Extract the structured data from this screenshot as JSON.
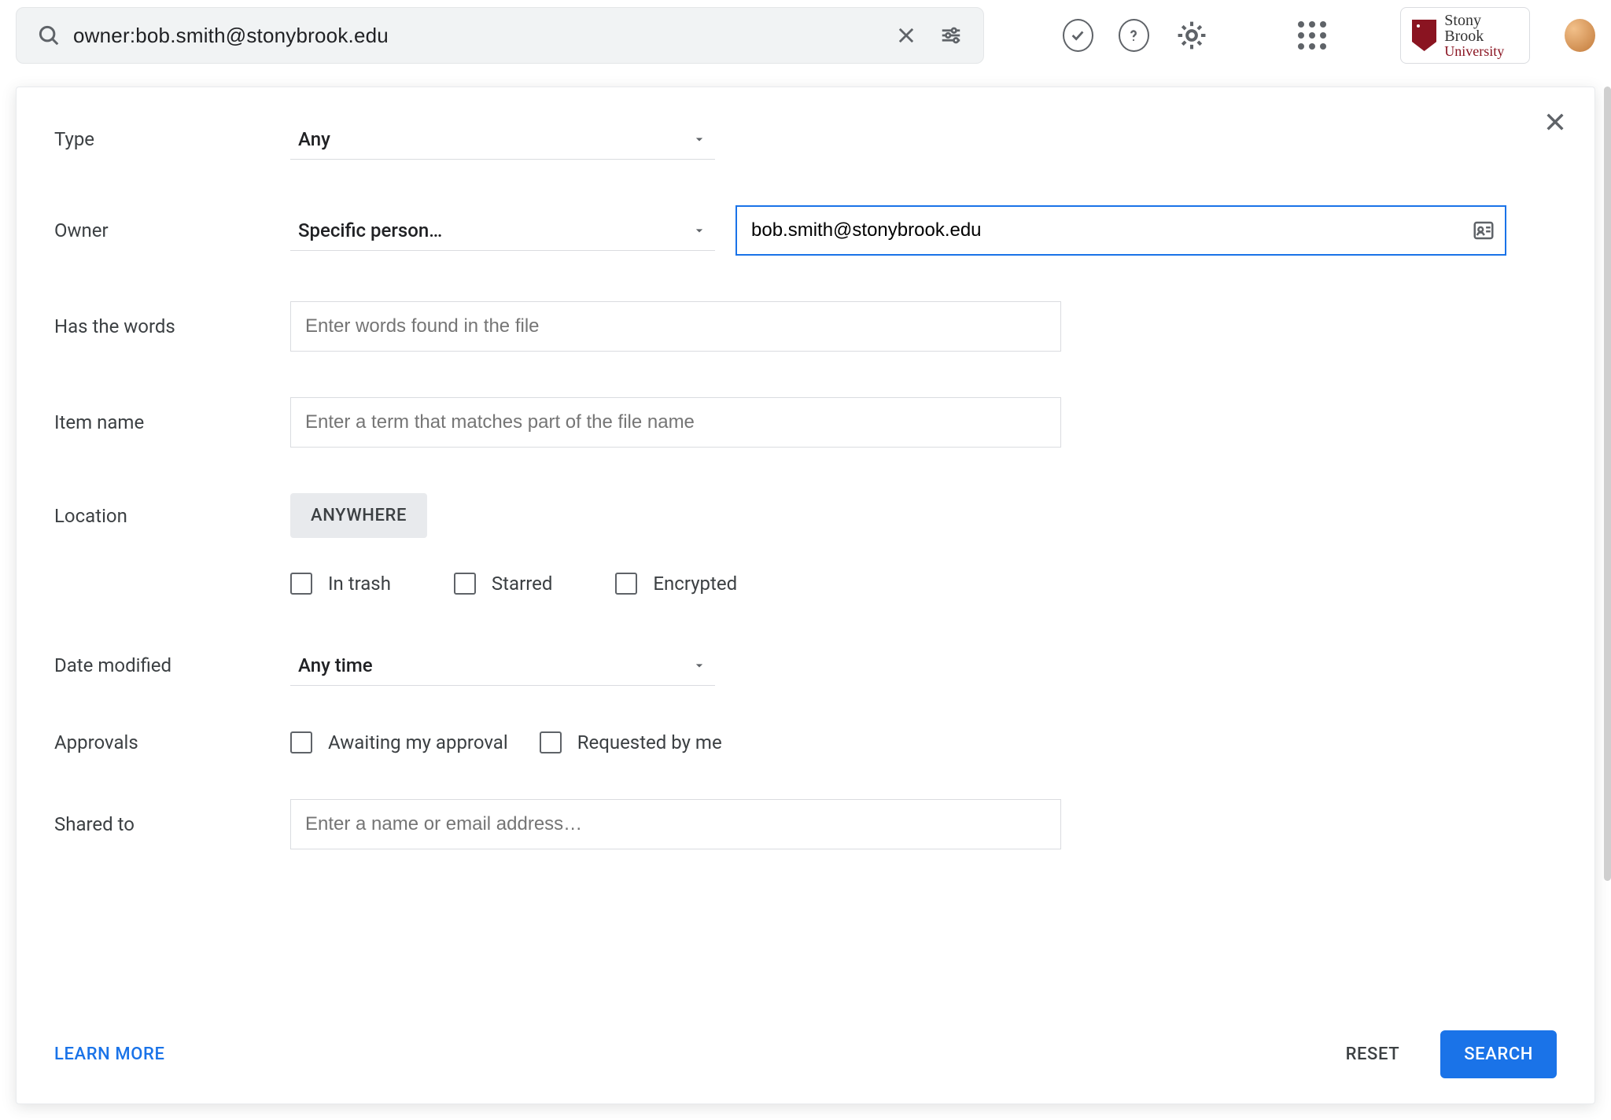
{
  "search": {
    "query": "owner:bob.smith@stonybrook.edu"
  },
  "org": {
    "line1": "Stony Brook",
    "line2": "University"
  },
  "filters": {
    "type": {
      "label": "Type",
      "value": "Any"
    },
    "owner": {
      "label": "Owner",
      "value": "Specific person…",
      "email": "bob.smith@stonybrook.edu"
    },
    "has_words": {
      "label": "Has the words",
      "placeholder": "Enter words found in the file"
    },
    "item_name": {
      "label": "Item name",
      "placeholder": "Enter a term that matches part of the file name"
    },
    "location": {
      "label": "Location",
      "chip": "ANYWHERE"
    },
    "checks": {
      "in_trash": "In trash",
      "starred": "Starred",
      "encrypted": "Encrypted"
    },
    "date_modified": {
      "label": "Date modified",
      "value": "Any time"
    },
    "approvals": {
      "label": "Approvals",
      "awaiting": "Awaiting my approval",
      "requested": "Requested by me"
    },
    "shared_to": {
      "label": "Shared to",
      "placeholder": "Enter a name or email address…"
    }
  },
  "footer": {
    "learn_more": "LEARN MORE",
    "reset": "RESET",
    "search": "SEARCH"
  }
}
